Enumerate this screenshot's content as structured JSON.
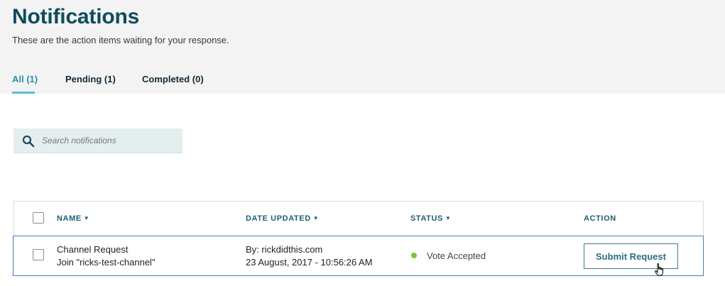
{
  "header": {
    "title": "Notifications",
    "subtitle": "These are the action items waiting for your response."
  },
  "tabs": [
    {
      "label": "All (1)",
      "active": true
    },
    {
      "label": "Pending (1)",
      "active": false
    },
    {
      "label": "Completed (0)",
      "active": false
    }
  ],
  "search": {
    "placeholder": "Search notifications",
    "value": "",
    "icon": "search-icon"
  },
  "table": {
    "columns": [
      "NAME",
      "DATE UPDATED",
      "STATUS",
      "ACTION"
    ],
    "rows": [
      {
        "name": "Channel Request",
        "detail": "Join \"ricks-test-channel\"",
        "by": "By: rickdidthis.com",
        "date": "23 August, 2017 - 10:56:26 AM",
        "status": "Vote Accepted",
        "status_color": "#7dc42c",
        "action": "Submit Request"
      }
    ]
  },
  "colors": {
    "accent": "#2b8fa8",
    "title": "#0f4c5c",
    "row_border": "#3d7ebd"
  }
}
